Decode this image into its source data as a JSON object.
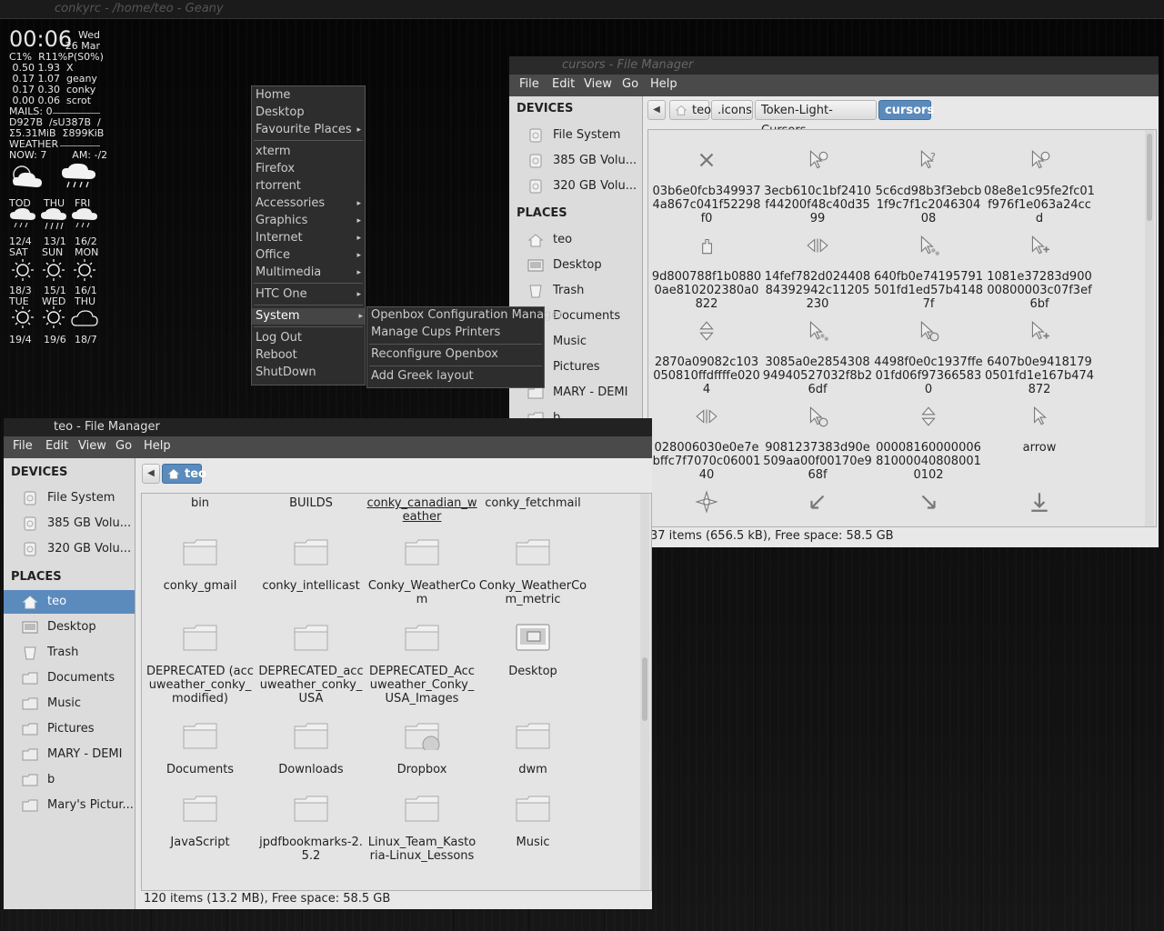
{
  "topbar": {
    "title": "conkyrc - /home/teo - Geany"
  },
  "conky": {
    "time": "00:06",
    "day": "Wed",
    "date": "26 Mar",
    "rows": [
      "C1%  R11%P(S0%)",
      " 0.50 1.93  X",
      " 0.17 1.07  geany",
      " 0.17 0.30  conky",
      " 0.00 0.06  scrot",
      "MAILS: 0",
      "D927B  /sU387B  /",
      "Σ5.31MiB  Σ899KiB",
      "WEATHER",
      "NOW: 7        AM: -/2"
    ],
    "forecast1": {
      "labels": [
        "TOD",
        "THU",
        "FRI"
      ],
      "temps": [
        "12/4",
        "13/1",
        "16/2"
      ]
    },
    "forecast2": {
      "labels": [
        "SAT",
        "SUN",
        "MON"
      ],
      "temps": [
        "18/3",
        "15/1",
        "16/1"
      ]
    },
    "forecast3": {
      "labels": [
        "TUE",
        "WED",
        "THU"
      ],
      "temps": [
        "19/4",
        "19/6",
        "18/7"
      ]
    }
  },
  "menu": {
    "items": [
      "Home",
      "Desktop",
      "Favourite Places",
      "xterm",
      "Firefox",
      "rtorrent",
      "Accessories",
      "Graphics",
      "Internet",
      "Office",
      "Multimedia",
      "HTC One",
      "System",
      "Log Out",
      "Reboot",
      "ShutDown"
    ],
    "submenu_arrow": "▸",
    "system_submenu": [
      "Openbox Configuration Manager",
      "Manage Cups Printers",
      "Reconfigure Openbox",
      "Add Greek layout"
    ]
  },
  "cursors_window": {
    "title": "cursors - File Manager",
    "menubar": [
      "File",
      "Edit",
      "View",
      "Go",
      "Help"
    ],
    "devices_header": "DEVICES",
    "devices": [
      "File System",
      "385 GB Volu...",
      "320 GB Volu..."
    ],
    "places_header": "PLACES",
    "places": [
      "teo",
      "Desktop",
      "Trash",
      "Documents",
      "Music",
      "Pictures",
      "MARY - DEMI",
      "b"
    ],
    "path": [
      "teo",
      ".icons",
      "Token-Light-Cursors",
      "cursors"
    ],
    "files": [
      "03b6e0fcb3499374a867c041f52298f0",
      "3ecb610c1bf2410f44200f48c40d3599",
      "5c6cd98b3f3ebcb1f9c7f1c204630408",
      "08e8e1c95fe2fc01f976f1e063a24ccd",
      "9d800788f1b08800ae810202380a0822",
      "14fef782d02440884392942c11205230",
      "640fb0e74195791501fd1ed57b41487f",
      "1081e37283d90000800003c07f3ef6bf",
      "2870a09082c103050810ffdffffe0204",
      "3085a0e285430894940527032f8b26df",
      "4498f0e0c1937ffe01fd06f973665830",
      "6407b0e94181790501fd1e167b474872",
      "028006030e0e7ebffc7f7070c0600140",
      "9081237383d90e509aa00f00170e968f",
      "00008160000006810000408080010102",
      "arrow"
    ],
    "status": "37 items (656.5 kB), Free space: 58.5 GB"
  },
  "teo_window": {
    "title": "teo - File Manager",
    "menubar": [
      "File",
      "Edit",
      "View",
      "Go",
      "Help"
    ],
    "devices_header": "DEVICES",
    "devices": [
      "File System",
      "385 GB Volu...",
      "320 GB Volu..."
    ],
    "places_header": "PLACES",
    "places": [
      "teo",
      "Desktop",
      "Trash",
      "Documents",
      "Music",
      "Pictures",
      "MARY - DEMI",
      "b",
      "Mary's Pictur..."
    ],
    "path": [
      "teo"
    ],
    "top_row": [
      "bin",
      "BUILDS",
      "conky_canadian_weather",
      "conky_fetchmail"
    ],
    "files": [
      "conky_gmail",
      "conky_intellicast",
      "Conky_WeatherCom",
      "Conky_WeatherCom_metric",
      "DEPRECATED (accuweather_conky_modified)",
      "DEPRECATED_accuweather_conky_USA",
      "DEPRECATED_Accuweather_Conky_USA_Images",
      "Desktop",
      "Documents",
      "Downloads",
      "Dropbox",
      "dwm",
      "JavaScript",
      "jpdfbookmarks-2.5.2",
      "Linux_Team_Kastoria-Linux_Lessons",
      "Music"
    ],
    "status": "120 items (13.2 MB), Free space: 58.5 GB"
  }
}
